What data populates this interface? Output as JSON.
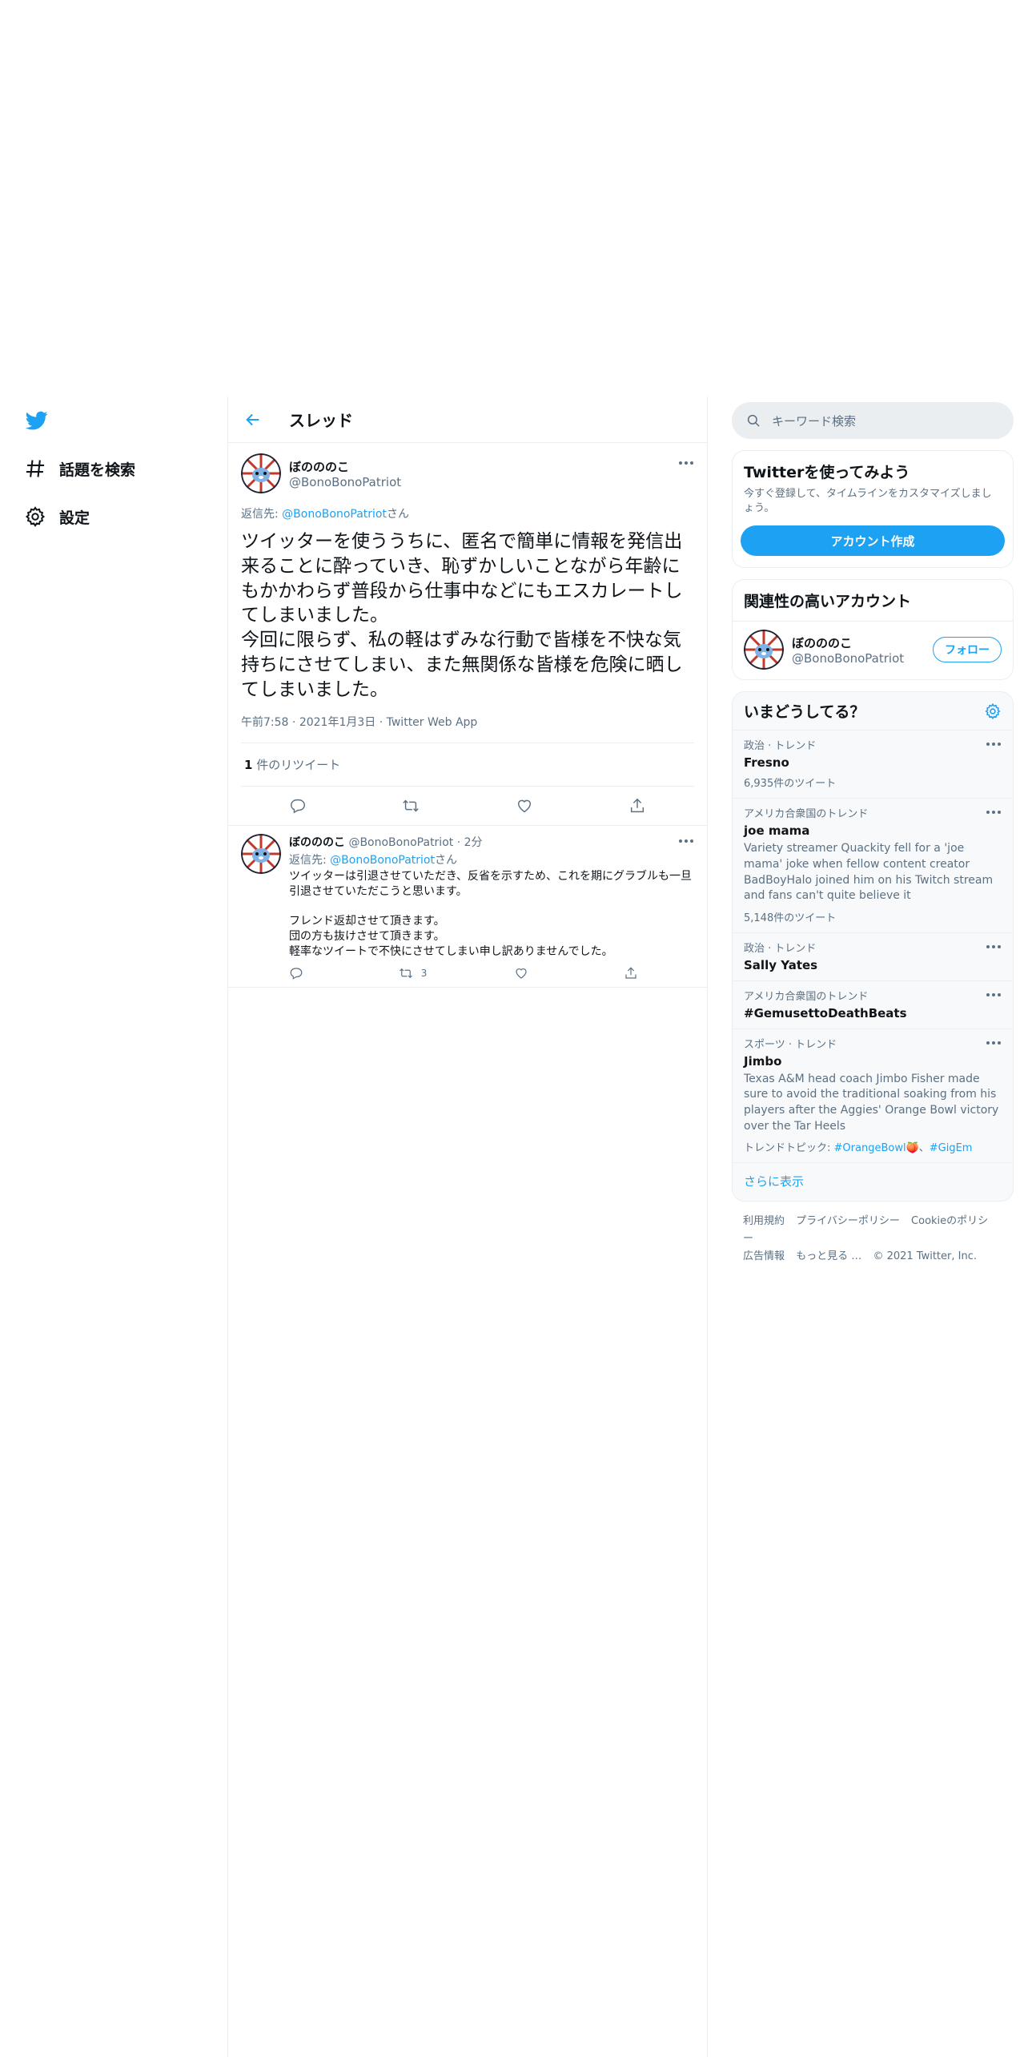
{
  "nav": {
    "items": [
      {
        "label": "話題を検索",
        "icon": "hashtag-icon"
      },
      {
        "label": "設定",
        "icon": "gear-icon"
      }
    ]
  },
  "header": {
    "title": "スレッド"
  },
  "main_tweet": {
    "display_name": "ぼのののこ",
    "handle": "@BonoBonoPatriot",
    "reply_prefix": "返信先: ",
    "reply_to": "@BonoBonoPatriot",
    "reply_suffix": "さん",
    "text": "ツイッターを使ううちに、匿名で簡単に情報を発信出来ることに酔っていき、恥ずかしいことながら年齢にもかかわらず普段から仕事中などにもエスカレートしてしまいました。\n今回に限らず、私の軽はずみな行動で皆様を不快な気持ちにさせてしまい、また無関係な皆様を危険に晒してしまいました。",
    "time": "午前7:58",
    "date": "2021年1月3日",
    "source": "Twitter Web App",
    "retweet_count": "1",
    "retweet_label": " 件のリツイート"
  },
  "reply_tweet": {
    "display_name": "ぼのののこ",
    "handle": "@BonoBonoPatriot",
    "time": "2分",
    "reply_prefix": "返信先: ",
    "reply_to": "@BonoBonoPatriot",
    "reply_suffix": "さん",
    "text": "ツイッターは引退させていただき、反省を示すため、これを期にグラブルも一旦引退させていただこうと思います。\n\nフレンド返却させて頂きます。\n団の方も抜けさせて頂きます。\n軽率なツイートで不快にさせてしまい申し訳ありませんでした。",
    "retweets": "3"
  },
  "search": {
    "placeholder": "キーワード検索"
  },
  "signup": {
    "title": "Twitterを使ってみよう",
    "text": "今すぐ登録して、タイムラインをカスタマイズしましょう。",
    "button": "アカウント作成"
  },
  "related": {
    "title": "関連性の高いアカウント",
    "display_name": "ぼのののこ",
    "handle": "@BonoBonoPatriot",
    "follow": "フォロー"
  },
  "whats_happening": {
    "title": "いまどうしてる？",
    "trends": [
      {
        "context": "政治 · トレンド",
        "name": "Fresno",
        "count": "6,935件のツイート"
      },
      {
        "context": "アメリカ合衆国のトレンド",
        "name": "joe mama",
        "description": "Variety streamer Quackity fell for a 'joe mama' joke when fellow content creator BadBoyHalo joined him on his Twitch stream and fans can't quite believe it",
        "count": "5,148件のツイート"
      },
      {
        "context": "政治 · トレンド",
        "name": "Sally Yates"
      },
      {
        "context": "アメリカ合衆国のトレンド",
        "name": "#GemusettoDeathBeats"
      },
      {
        "context": "スポーツ · トレンド",
        "name": "Jimbo",
        "description": "Texas A&M head coach Jimbo Fisher made sure to avoid the traditional soaking from his players after the Aggies' Orange Bowl victory over the Tar Heels",
        "topics_label": "トレンドトピック: ",
        "topic1": "#OrangeBowl",
        "topic_sep": "、",
        "topic2": "#GigEm"
      }
    ],
    "show_more": "さらに表示"
  },
  "footer": {
    "links": [
      "利用規約",
      "プライバシーポリシー",
      "Cookieのポリシー",
      "広告情報",
      "もっと見る …",
      "© 2021 Twitter, Inc."
    ]
  },
  "colors": {
    "accent": "#1da1f2",
    "secondary_text": "#5b7083",
    "border": "#ebeef0"
  }
}
